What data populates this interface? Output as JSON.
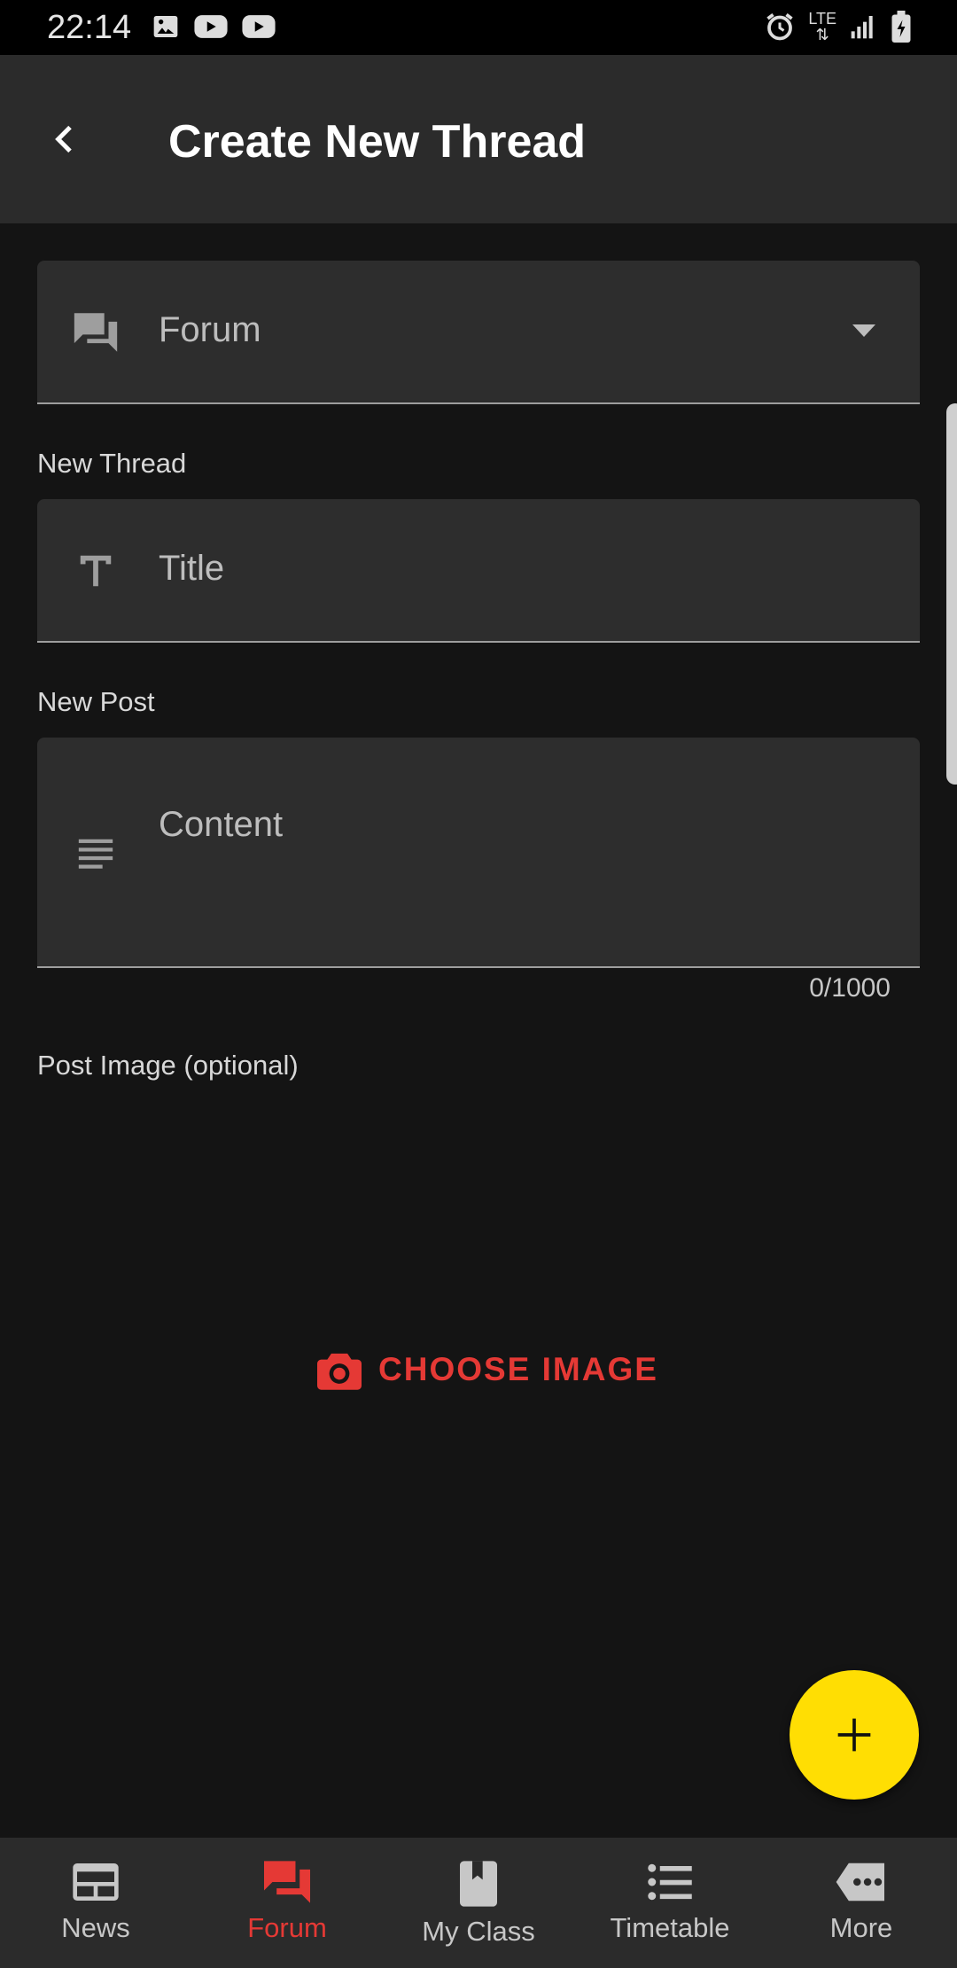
{
  "status_bar": {
    "time": "22:14",
    "left_icons": [
      "image-icon",
      "youtube-icon",
      "youtube-icon"
    ],
    "network_label": "LTE",
    "right_icons": [
      "alarm-icon",
      "lte-icon",
      "signal-icon",
      "battery-charging-icon"
    ]
  },
  "app_bar": {
    "back_icon": "chevron-left-icon",
    "title": "Create New Thread"
  },
  "form": {
    "forum_select": {
      "icon": "forum-icon",
      "value": "Forum",
      "dropdown_icon": "arrow-drop-down-icon"
    },
    "new_thread_label": "New Thread",
    "title_field": {
      "icon": "text-format-icon",
      "placeholder": "Title"
    },
    "new_post_label": "New Post",
    "content_field": {
      "icon": "subject-icon",
      "placeholder": "Content",
      "counter": "0/1000"
    },
    "post_image_label": "Post Image (optional)",
    "choose_image": {
      "icon": "camera-icon",
      "label": "CHOOSE IMAGE"
    }
  },
  "fab": {
    "icon": "plus-icon"
  },
  "bottom_nav": {
    "active": "Forum",
    "items": [
      {
        "label": "News",
        "icon": "news-icon"
      },
      {
        "label": "Forum",
        "icon": "forum-icon"
      },
      {
        "label": "My Class",
        "icon": "book-icon"
      },
      {
        "label": "Timetable",
        "icon": "list-icon"
      },
      {
        "label": "More",
        "icon": "more-tag-icon"
      }
    ]
  },
  "colors": {
    "accent_red": "#e53935",
    "fab_yellow": "#ffde03",
    "background": "#141414",
    "surface": "#2d2d2d"
  }
}
